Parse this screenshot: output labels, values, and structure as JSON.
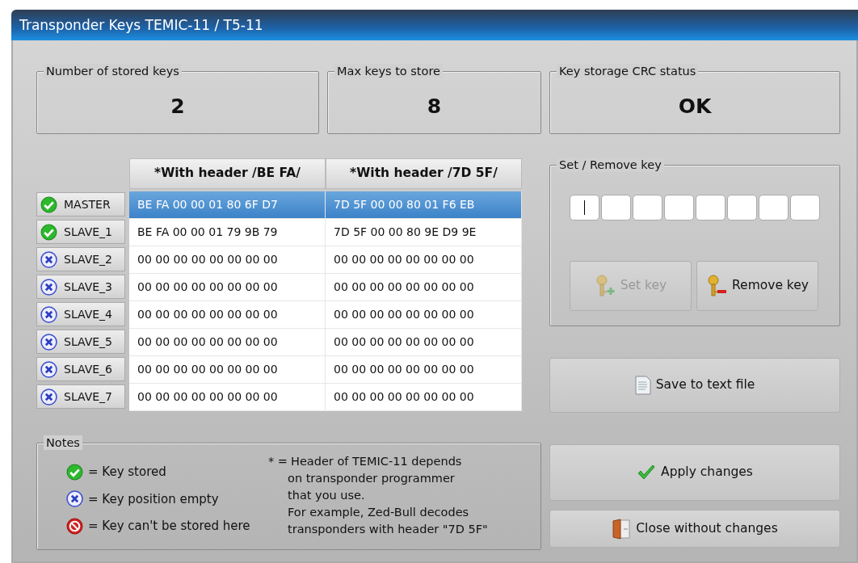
{
  "window": {
    "title": "Transponder Keys TEMIC-11 / T5-11"
  },
  "stats": [
    {
      "label": "Number of stored keys",
      "value": "2"
    },
    {
      "label": "Max keys to store",
      "value": "8"
    },
    {
      "label": "Key storage CRC status",
      "value": "OK"
    }
  ],
  "table": {
    "columns": [
      "*With header /BE FA/",
      "*With header /7D 5F/"
    ],
    "rows": [
      {
        "name": "MASTER",
        "kind": "stored",
        "selected": true,
        "cells": [
          "BE FA 00 00 01 80 6F D7",
          "7D 5F 00 00 80 01 F6 EB"
        ]
      },
      {
        "name": "SLAVE_1",
        "kind": "stored",
        "selected": false,
        "cells": [
          "BE FA 00 00 01 79 9B 79",
          "7D 5F 00 00 80 9E D9 9E"
        ]
      },
      {
        "name": "SLAVE_2",
        "kind": "empty",
        "selected": false,
        "cells": [
          "00 00 00 00 00 00 00 00",
          "00 00 00 00 00 00 00 00"
        ]
      },
      {
        "name": "SLAVE_3",
        "kind": "empty",
        "selected": false,
        "cells": [
          "00 00 00 00 00 00 00 00",
          "00 00 00 00 00 00 00 00"
        ]
      },
      {
        "name": "SLAVE_4",
        "kind": "empty",
        "selected": false,
        "cells": [
          "00 00 00 00 00 00 00 00",
          "00 00 00 00 00 00 00 00"
        ]
      },
      {
        "name": "SLAVE_5",
        "kind": "empty",
        "selected": false,
        "cells": [
          "00 00 00 00 00 00 00 00",
          "00 00 00 00 00 00 00 00"
        ]
      },
      {
        "name": "SLAVE_6",
        "kind": "empty",
        "selected": false,
        "cells": [
          "00 00 00 00 00 00 00 00",
          "00 00 00 00 00 00 00 00"
        ]
      },
      {
        "name": "SLAVE_7",
        "kind": "empty",
        "selected": false,
        "cells": [
          "00 00 00 00 00 00 00 00",
          "00 00 00 00 00 00 00 00"
        ]
      }
    ]
  },
  "notes": {
    "title": "Notes",
    "legend": [
      {
        "kind": "stored",
        "text": "= Key stored"
      },
      {
        "kind": "empty",
        "text": "= Key position empty"
      },
      {
        "kind": "blocked",
        "text": "= Key can't be stored here"
      }
    ],
    "footnote_mark": "* =",
    "footnote_lines": [
      "Header of TEMIC-11 depends",
      "on transponder programmer",
      "that you use.",
      "For example, Zed-Bull decodes",
      "transponders with header \"7D 5F\""
    ]
  },
  "key_editor": {
    "title": "Set / Remove key",
    "cells": [
      {
        "caret": true
      },
      {
        "caret": false
      },
      {
        "caret": false
      },
      {
        "caret": false
      },
      {
        "caret": false
      },
      {
        "caret": false
      },
      {
        "caret": false
      },
      {
        "caret": false
      }
    ],
    "buttons": [
      {
        "kind": "set",
        "label": "Set key",
        "disabled": true
      },
      {
        "kind": "remove",
        "label": "Remove key",
        "disabled": false
      }
    ]
  },
  "actions": [
    {
      "kind": "save",
      "label": "Save to text file"
    },
    {
      "kind": "apply",
      "label": "Apply changes"
    },
    {
      "kind": "close",
      "label": "Close without changes"
    }
  ]
}
